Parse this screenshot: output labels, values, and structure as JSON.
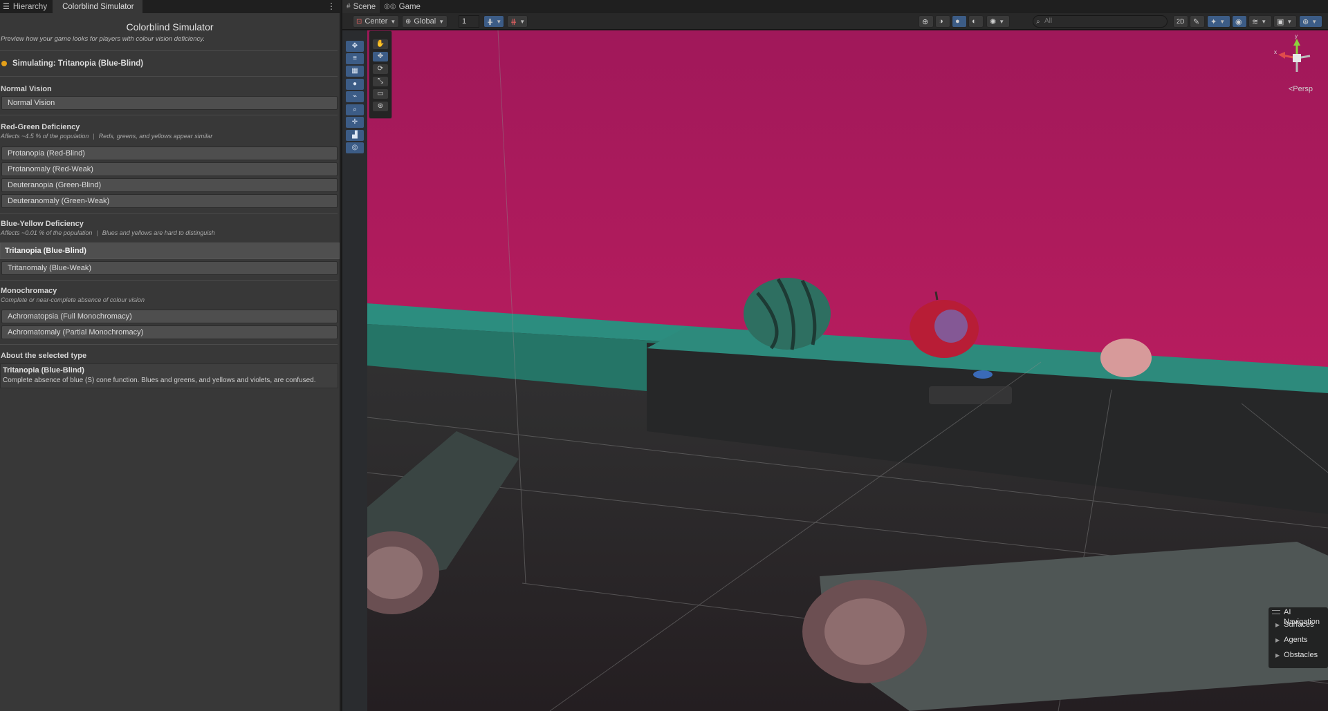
{
  "left_tabs": [
    {
      "label": "Hierarchy",
      "icon": "list-icon"
    },
    {
      "label": "Colorblind Simulator"
    }
  ],
  "panel": {
    "title": "Colorblind Simulator",
    "subtitle": "Preview how your game looks for players with colour vision deficiency.",
    "simulating": "Simulating: Tritanopia  (Blue-Blind)",
    "status_color": "#e5a019",
    "normal": {
      "heading": "Normal Vision",
      "options": [
        "Normal Vision"
      ]
    },
    "red_green": {
      "heading": "Red-Green Deficiency",
      "affects": "Affects ~4.5 % of the population",
      "note": "Reds, greens, and yellows appear similar",
      "options": [
        "Protanopia  (Red-Blind)",
        "Protanomaly  (Red-Weak)",
        "Deuteranopia  (Green-Blind)",
        "Deuteranomaly  (Green-Weak)"
      ]
    },
    "blue_yellow": {
      "heading": "Blue-Yellow Deficiency",
      "affects": "Affects ~0.01 % of the population",
      "note": "Blues and yellows are hard to distinguish",
      "options": [
        "Tritanopia  (Blue-Blind)",
        "Tritanomaly  (Blue-Weak)"
      ],
      "selected_index": 0
    },
    "mono": {
      "heading": "Monochromacy",
      "note": "Complete or near-complete absence of colour vision",
      "options": [
        "Achromatopsia  (Full Monochromacy)",
        "Achromatomaly  (Partial Monochromacy)"
      ]
    },
    "about": {
      "heading": "About the selected type",
      "title": "Tritanopia  (Blue-Blind)",
      "description": "Complete absence of blue (S) cone function. Blues and greens, and yellows and violets, are confused."
    }
  },
  "right_tabs": [
    {
      "label": "Scene",
      "icon": "grid-icon"
    },
    {
      "label": "Game",
      "icon": "gamepad-icon"
    }
  ],
  "toolbar": {
    "pivot": "Center",
    "space": "Global",
    "grid_value": "1",
    "search_placeholder": "All"
  },
  "viewport": {
    "camera_label": "Persp",
    "gizmo_axes": {
      "y": "y",
      "x": "x"
    },
    "ai_navigation": {
      "title": "AI Navigation",
      "items": [
        "Surfaces",
        "Agents",
        "Obstacles"
      ]
    }
  },
  "colors": {
    "accent": "#3c5c86",
    "sky": "#a81a58",
    "ledge": "#2d8f80"
  }
}
